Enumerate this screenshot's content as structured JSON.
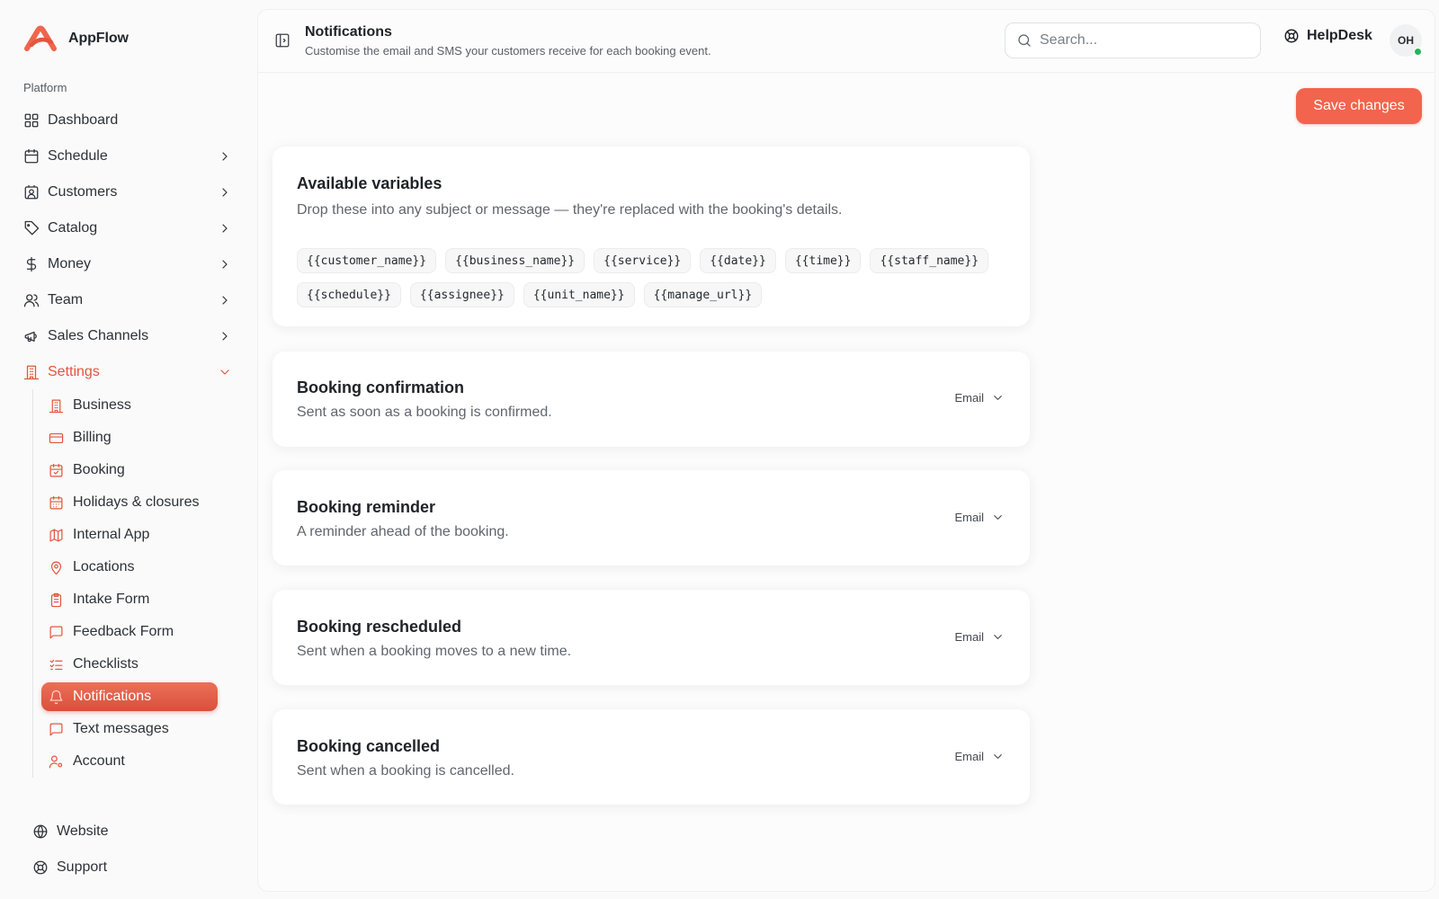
{
  "brand": {
    "name": "AppFlow",
    "accent": "#f2644d"
  },
  "sidebar": {
    "section_label": "Platform",
    "items": [
      {
        "label": "Dashboard",
        "icon": "grid-icon",
        "has_chevron": false
      },
      {
        "label": "Schedule",
        "icon": "calendar-icon",
        "has_chevron": true
      },
      {
        "label": "Customers",
        "icon": "contact-icon",
        "has_chevron": true
      },
      {
        "label": "Catalog",
        "icon": "tag-icon",
        "has_chevron": true
      },
      {
        "label": "Money",
        "icon": "dollar-icon",
        "has_chevron": true
      },
      {
        "label": "Team",
        "icon": "users-icon",
        "has_chevron": true
      },
      {
        "label": "Sales Channels",
        "icon": "megaphone-icon",
        "has_chevron": true
      },
      {
        "label": "Settings",
        "icon": "building-icon",
        "has_chevron": true,
        "expanded": true
      }
    ],
    "settings_items": [
      {
        "label": "Business",
        "icon": "building-icon"
      },
      {
        "label": "Billing",
        "icon": "credit-card-icon"
      },
      {
        "label": "Booking",
        "icon": "calendar-check-icon"
      },
      {
        "label": "Holidays & closures",
        "icon": "calendar-icon"
      },
      {
        "label": "Internal App",
        "icon": "map-icon"
      },
      {
        "label": "Locations",
        "icon": "map-pin-icon"
      },
      {
        "label": "Intake Form",
        "icon": "clipboard-icon"
      },
      {
        "label": "Feedback Form",
        "icon": "message-square-icon"
      },
      {
        "label": "Checklists",
        "icon": "list-checks-icon"
      },
      {
        "label": "Notifications",
        "icon": "bell-icon",
        "selected": true
      },
      {
        "label": "Text messages",
        "icon": "message-square-icon"
      },
      {
        "label": "Account",
        "icon": "user-cog-icon"
      }
    ],
    "bottom_items": [
      {
        "label": "Website",
        "icon": "globe-icon"
      },
      {
        "label": "Support",
        "icon": "life-buoy-icon"
      }
    ]
  },
  "header": {
    "title": "Notifications",
    "subtitle": "Customise the email and SMS your customers receive for each booking event.",
    "search_placeholder": "Search...",
    "helpdesk_label": "HelpDesk",
    "avatar_initials": "OH",
    "status_color": "#23b45a"
  },
  "actions": {
    "save_label": "Save changes"
  },
  "variables_card": {
    "title": "Available variables",
    "description": "Drop these into any subject or message — they're replaced with the booking's details.",
    "variables": [
      "{{customer_name}}",
      "{{business_name}}",
      "{{service}}",
      "{{date}}",
      "{{time}}",
      "{{staff_name}}",
      "{{schedule}}",
      "{{assignee}}",
      "{{unit_name}}",
      "{{manage_url}}"
    ]
  },
  "events": [
    {
      "title": "Booking confirmation",
      "description": "Sent as soon as a booking is confirmed.",
      "channel": "Email"
    },
    {
      "title": "Booking reminder",
      "description": "A reminder ahead of the booking.",
      "channel": "Email"
    },
    {
      "title": "Booking rescheduled",
      "description": "Sent when a booking moves to a new time.",
      "channel": "Email"
    },
    {
      "title": "Booking cancelled",
      "description": "Sent when a booking is cancelled.",
      "channel": "Email"
    }
  ]
}
